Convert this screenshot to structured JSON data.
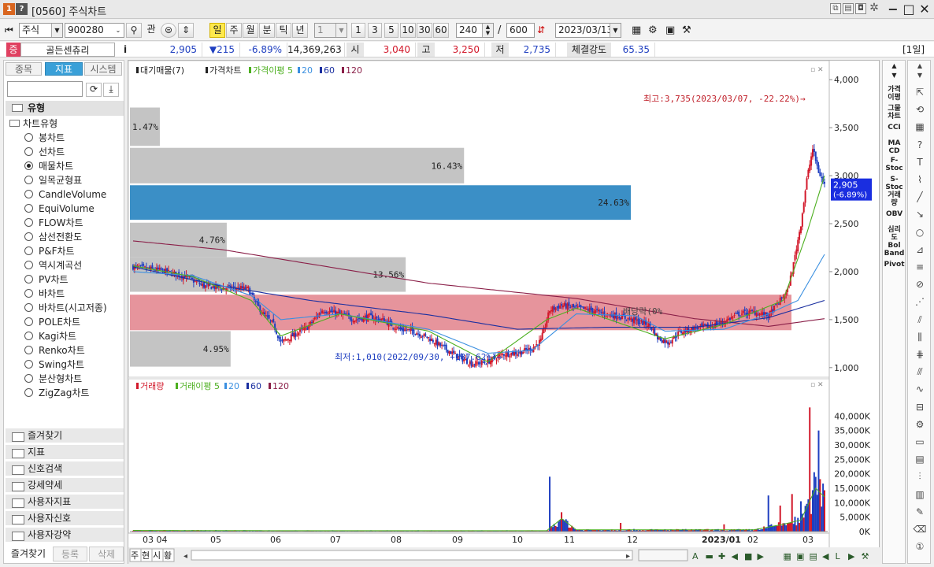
{
  "window": {
    "screen_no": "[0560]",
    "title": "주식차트",
    "help": "?",
    "app_num": "1"
  },
  "toolbar": {
    "market": "주식",
    "code": "900280",
    "btn_gwan": "관",
    "periods": [
      "일",
      "주",
      "월",
      "분",
      "틱",
      "년"
    ],
    "active_period": "일",
    "unit_value": "1",
    "quick_units": [
      "1",
      "3",
      "5",
      "10",
      "30",
      "60"
    ],
    "count": "240",
    "slash": "/",
    "total": "600",
    "date": "2023/03/13"
  },
  "quote": {
    "badge": "증",
    "name": "골든센츄리",
    "info": "i",
    "price": "2,905",
    "change": "▼215",
    "rate": "-6.89%",
    "volume": "14,369,263",
    "open_label": "시",
    "open": "3,040",
    "high_label": "고",
    "high": "3,250",
    "low_label": "저",
    "low": "2,735",
    "strength_label": "체결강도",
    "strength": "65.35",
    "period_tag": "[1일]"
  },
  "left": {
    "tabs": [
      "종목",
      "지표",
      "시스템"
    ],
    "active_tab": "지표",
    "group": "유형",
    "subgroup": "차트유형",
    "chart_types": [
      "봉차트",
      "선차트",
      "매물차트",
      "일목균형표",
      "CandleVolume",
      "EquiVolume",
      "FLOW차트",
      "삼선전환도",
      "P&F차트",
      "역시계곡선",
      "PV차트",
      "바차트",
      "바차트(시고저종)",
      "POLE차트",
      "Kagi차트",
      "Renko차트",
      "Swing차트",
      "분산형차트",
      "ZigZag차트"
    ],
    "selected_type": "매물차트",
    "folders": [
      "즐겨찾기",
      "지표",
      "신호검색",
      "강세약세",
      "사용자지표",
      "사용자신호",
      "사용자강약"
    ],
    "bottom_tabs": [
      "즐겨찾기",
      "등록",
      "삭제"
    ]
  },
  "chart": {
    "legend_top": [
      "대기매물(7)",
      "가격차트",
      "가격이평 5",
      "20",
      "60",
      "120"
    ],
    "legend_vol": [
      "거래량",
      "거래이평 5",
      "20",
      "60",
      "120"
    ],
    "annot_high": "최고:3,735(2023/03/07, -22.22%)→",
    "annot_low": "최저:1,010(2022/09/30, +187.62%)→",
    "annot_div": "배당락(0%",
    "price_tag": "2,905",
    "price_tag_rate": "(-6.89%)",
    "bottom_left_tabs": [
      "주",
      "현",
      "시",
      "황"
    ],
    "x_labels": [
      "03 04",
      "05",
      "06",
      "07",
      "08",
      "09",
      "10",
      "11",
      "12",
      "2023/01",
      "02",
      "03"
    ],
    "colors": {
      "ma5": "#4caf1f",
      "ma20": "#3a8fe0",
      "ma60": "#1a2fa0",
      "ma120": "#8a1f48",
      "up": "#d2182a",
      "down": "#1f3fc0",
      "profile": "#c4c4c4",
      "profile_cur": "#3b8fc6",
      "profile_band": "#e6949c"
    }
  },
  "chart_data": {
    "type": "candlestick",
    "price_axis": {
      "min": 900,
      "max": 4100,
      "ticks": [
        1000,
        1500,
        2000,
        2500,
        3000,
        3500,
        4000
      ],
      "tick_labels": [
        "1,000",
        "1,500",
        "2,000",
        "2,500",
        "3,000",
        "3,500",
        "4,000"
      ]
    },
    "volume_axis": {
      "min": 0,
      "max": 45000,
      "ticks": [
        0,
        5000,
        10000,
        15000,
        20000,
        25000,
        30000,
        35000,
        40000
      ],
      "tick_labels": [
        "0K",
        "5,000K",
        "10,000K",
        "15,000K",
        "20,000K",
        "25,000K",
        "30,000K",
        "35,000K",
        "40,000K"
      ]
    },
    "volume_profile": [
      {
        "label": "4.95%",
        "pct": 4.95,
        "low": 1010,
        "high": 1380
      },
      {
        "label": "",
        "pct": 12.0,
        "low": 1390,
        "high": 1760
      },
      {
        "label": "13.56%",
        "pct": 13.56,
        "low": 1790,
        "high": 2150
      },
      {
        "label": "4.76%",
        "pct": 4.76,
        "low": 2150,
        "high": 2510
      },
      {
        "label": "24.63%",
        "pct": 24.63,
        "low": 2540,
        "high": 2900
      },
      {
        "label": "16.43%",
        "pct": 16.43,
        "low": 2920,
        "high": 3290
      },
      {
        "label": "1.47%",
        "pct": 1.47,
        "low": 3310,
        "high": 3710
      }
    ],
    "profile_pct_max": 24.63,
    "price_keypoints": [
      [
        0,
        2050
      ],
      [
        20,
        2010
      ],
      [
        35,
        1950
      ],
      [
        48,
        1850
      ],
      [
        60,
        1830
      ],
      [
        70,
        1830
      ],
      [
        78,
        1820
      ],
      [
        82,
        1700
      ],
      [
        88,
        1560
      ],
      [
        95,
        1450
      ],
      [
        100,
        1260
      ],
      [
        110,
        1350
      ],
      [
        118,
        1420
      ],
      [
        128,
        1600
      ],
      [
        140,
        1560
      ],
      [
        150,
        1500
      ],
      [
        160,
        1530
      ],
      [
        170,
        1490
      ],
      [
        180,
        1400
      ],
      [
        190,
        1380
      ],
      [
        200,
        1310
      ],
      [
        210,
        1210
      ],
      [
        220,
        1110
      ],
      [
        230,
        1040
      ],
      [
        240,
        1060
      ],
      [
        250,
        1140
      ],
      [
        262,
        1160
      ],
      [
        270,
        1200
      ],
      [
        276,
        1280
      ],
      [
        282,
        1600
      ],
      [
        290,
        1650
      ],
      [
        300,
        1620
      ],
      [
        310,
        1600
      ],
      [
        320,
        1560
      ],
      [
        330,
        1530
      ],
      [
        340,
        1490
      ],
      [
        350,
        1440
      ],
      [
        355,
        1310
      ],
      [
        362,
        1260
      ],
      [
        370,
        1370
      ],
      [
        380,
        1410
      ],
      [
        390,
        1430
      ],
      [
        400,
        1480
      ],
      [
        410,
        1560
      ],
      [
        420,
        1580
      ],
      [
        430,
        1540
      ],
      [
        438,
        1700
      ],
      [
        443,
        1800
      ],
      [
        447,
        2080
      ],
      [
        452,
        2500
      ],
      [
        456,
        2960
      ],
      [
        460,
        3280
      ],
      [
        464,
        3040
      ],
      [
        468,
        2905
      ]
    ],
    "ma_keypoints": {
      "ma120": [
        [
          0,
          2320
        ],
        [
          60,
          2230
        ],
        [
          120,
          2080
        ],
        [
          200,
          1880
        ],
        [
          300,
          1720
        ],
        [
          380,
          1510
        ],
        [
          430,
          1430
        ],
        [
          468,
          1510
        ]
      ],
      "ma60": [
        [
          0,
          2050
        ],
        [
          60,
          1850
        ],
        [
          120,
          1700
        ],
        [
          200,
          1550
        ],
        [
          260,
          1400
        ],
        [
          320,
          1420
        ],
        [
          380,
          1420
        ],
        [
          430,
          1520
        ],
        [
          468,
          1700
        ]
      ],
      "ma20": [
        [
          0,
          2000
        ],
        [
          40,
          1960
        ],
        [
          80,
          1750
        ],
        [
          100,
          1500
        ],
        [
          140,
          1560
        ],
        [
          200,
          1400
        ],
        [
          240,
          1150
        ],
        [
          270,
          1180
        ],
        [
          300,
          1560
        ],
        [
          340,
          1540
        ],
        [
          360,
          1380
        ],
        [
          400,
          1400
        ],
        [
          430,
          1560
        ],
        [
          450,
          1700
        ],
        [
          468,
          2180
        ]
      ],
      "ma5": [
        [
          0,
          2060
        ],
        [
          40,
          1950
        ],
        [
          80,
          1700
        ],
        [
          100,
          1330
        ],
        [
          140,
          1560
        ],
        [
          200,
          1380
        ],
        [
          240,
          1060
        ],
        [
          280,
          1500
        ],
        [
          300,
          1620
        ],
        [
          360,
          1300
        ],
        [
          400,
          1450
        ],
        [
          440,
          1700
        ],
        [
          456,
          2400
        ],
        [
          468,
          3000
        ]
      ]
    },
    "volume_spikes": [
      [
        282,
        19000
      ],
      [
        330,
        3000
      ],
      [
        400,
        2500
      ],
      [
        430,
        12500
      ],
      [
        438,
        9000
      ],
      [
        446,
        13000
      ],
      [
        452,
        10500
      ],
      [
        458,
        43000
      ],
      [
        464,
        35000
      ],
      [
        468,
        14300
      ]
    ],
    "volume_ma_keypoints": [
      [
        0,
        400
      ],
      [
        100,
        300
      ],
      [
        280,
        300
      ],
      [
        290,
        4500
      ],
      [
        300,
        600
      ],
      [
        420,
        600
      ],
      [
        440,
        2500
      ],
      [
        452,
        4000
      ],
      [
        462,
        15000
      ],
      [
        468,
        12000
      ]
    ],
    "n_bars": 469
  }
}
